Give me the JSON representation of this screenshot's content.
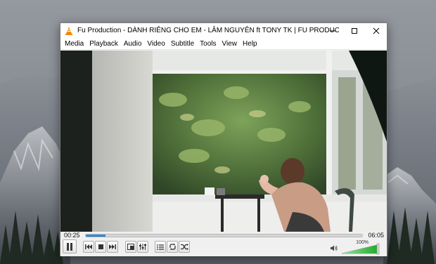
{
  "window": {
    "title": "Fu Production - DÀNH RIÊNG CHO EM - LÂM NGUYÊN ft TONY TK | FU PRODUCTION - VLC medi...",
    "app_icon": "vlc-cone-icon",
    "buttons": [
      "minimize-icon",
      "maximize-icon",
      "close-icon"
    ]
  },
  "menu": [
    "Media",
    "Playback",
    "Audio",
    "Video",
    "Subtitle",
    "Tools",
    "View",
    "Help"
  ],
  "player": {
    "elapsed": "00:25",
    "total": "06:05",
    "progress_fraction": 0.07,
    "volume_label": "100%",
    "volume_fraction": 1.0,
    "controls": [
      "pause-icon",
      "previous-icon",
      "stop-icon",
      "next-icon",
      "fullscreen-icon",
      "extended-settings-icon",
      "playlist-icon",
      "loop-icon",
      "shuffle-icon",
      "speaker-icon"
    ]
  },
  "colors": {
    "progress": "#1f6fbf",
    "volume": "#2fbf3c",
    "vlc_orange": "#f08a00"
  }
}
